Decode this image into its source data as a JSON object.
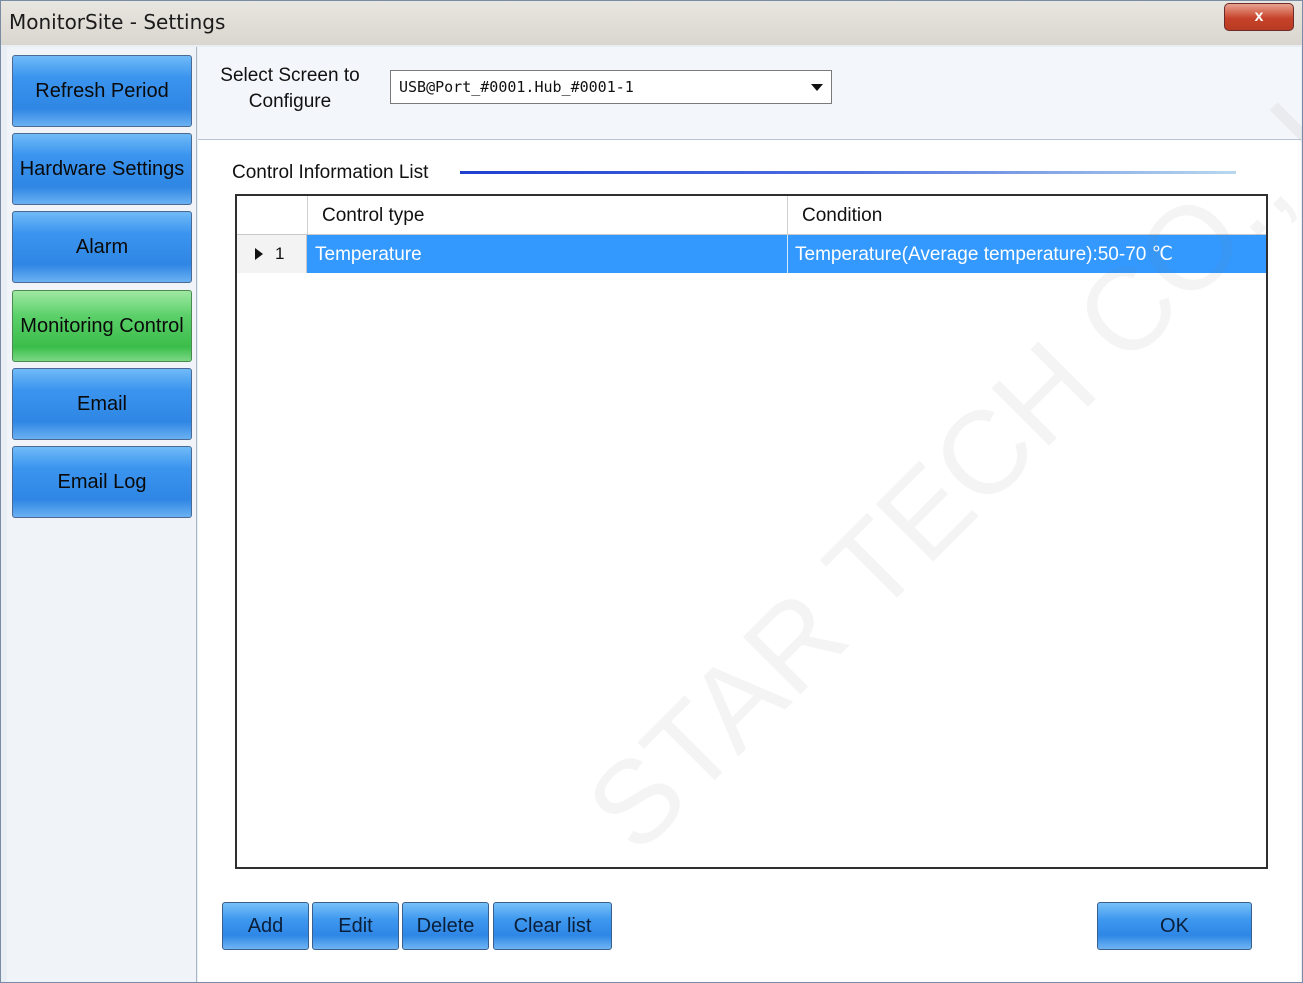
{
  "window": {
    "title": "MonitorSite - Settings",
    "close_glyph": "x"
  },
  "sidebar": {
    "items": [
      {
        "label": "Refresh Period"
      },
      {
        "label": "Hardware Settings"
      },
      {
        "label": "Alarm"
      },
      {
        "label": "Monitoring Control",
        "active": true
      },
      {
        "label": "Email"
      },
      {
        "label": "Email Log"
      }
    ]
  },
  "screen": {
    "label": "Select Screen to Configure",
    "selected": "USB@Port_#0001.Hub_#0001-1"
  },
  "list": {
    "group_title": "Control Information List",
    "columns": [
      "Control type",
      "Condition"
    ],
    "rows": [
      {
        "index": "1",
        "control_type": "Temperature",
        "condition": "Temperature(Average temperature):50-70 ℃",
        "selected": true
      }
    ]
  },
  "buttons": {
    "add": "Add",
    "edit": "Edit",
    "delete": "Delete",
    "clear": "Clear list",
    "ok": "OK"
  },
  "watermark": "STAR TECH CO., L",
  "colors": {
    "nav_button": "#3b95ef",
    "nav_active": "#5cd06a",
    "row_selected": "#3399ff",
    "close_button": "#c7432b"
  }
}
